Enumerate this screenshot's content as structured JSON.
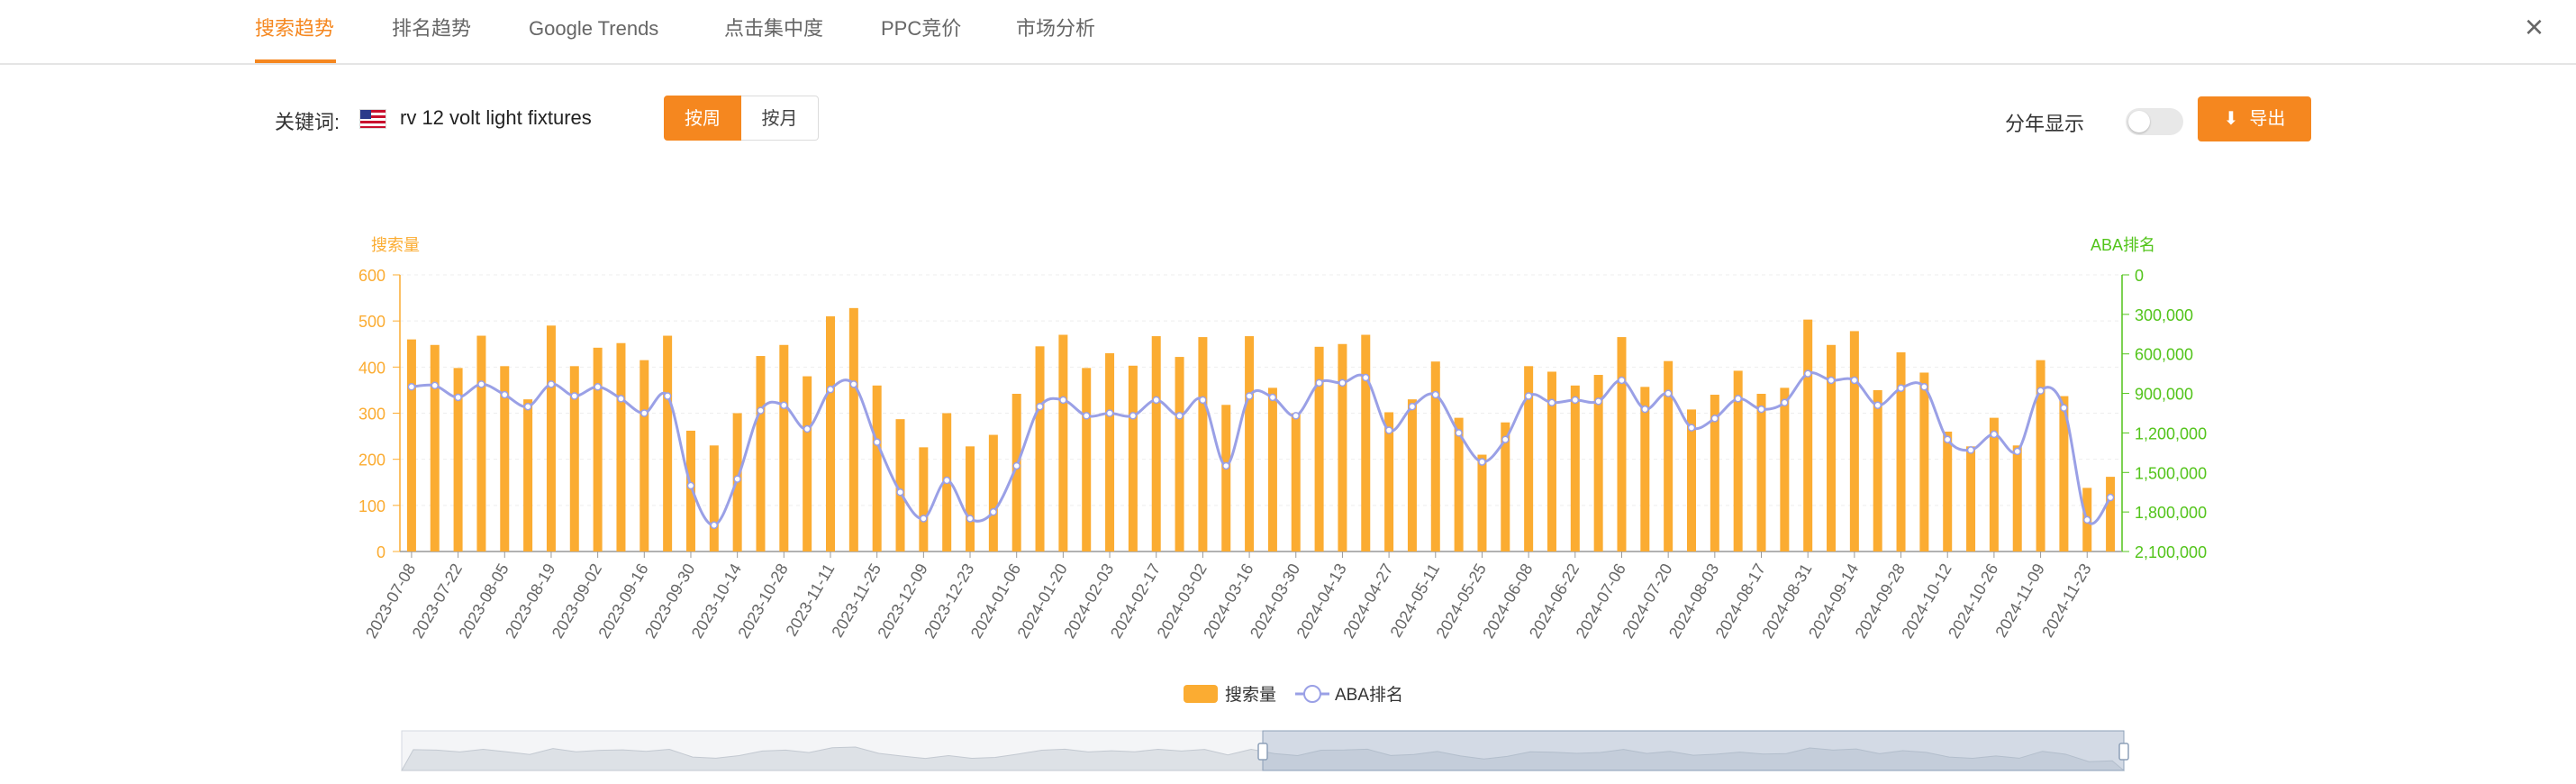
{
  "tabs": [
    {
      "label": "搜索趋势",
      "active": true
    },
    {
      "label": "排名趋势",
      "active": false
    },
    {
      "label": "Google Trends",
      "active": false
    },
    {
      "label": "点击集中度",
      "active": false
    },
    {
      "label": "PPC竞价",
      "active": false
    },
    {
      "label": "市场分析",
      "active": false
    }
  ],
  "close_icon": "×",
  "keyword": {
    "label": "关键词:",
    "flag_icon": "us-flag-icon",
    "value": "rv 12 volt light fixtures"
  },
  "period_toggle": {
    "weekly": "按周",
    "monthly": "按月",
    "selected": "按周"
  },
  "year_split": {
    "label": "分年显示",
    "on": false
  },
  "export_button": {
    "label": "导出",
    "icon": "download-icon"
  },
  "colors": {
    "accent": "#f5871f",
    "bar": "#fbac32",
    "line": "#9aa0e6",
    "right_axis": "#52c41a"
  },
  "chart_data": {
    "type": "bar",
    "y_left_label": "搜索量",
    "y_right_label": "ABA排名",
    "ylim_left": [
      0,
      600
    ],
    "yticks_left": [
      "0",
      "100",
      "200",
      "300",
      "400",
      "500",
      "600"
    ],
    "ylim_right": [
      0,
      2100000
    ],
    "yticks_right": [
      "0",
      "300,000",
      "600,000",
      "900,000",
      "1,200,000",
      "1,500,000",
      "1,800,000",
      "2,100,000"
    ],
    "right_axis_inverted": true,
    "grid": true,
    "legend_position": "bottom",
    "series": [
      {
        "name": "搜索量",
        "type": "bar",
        "values": [
          460,
          448,
          398,
          468,
          402,
          330,
          490,
          402,
          442,
          452,
          415,
          468,
          262,
          230,
          300,
          424,
          448,
          380,
          510,
          528,
          360,
          287,
          226,
          300,
          228,
          253,
          342,
          445,
          470,
          398,
          430,
          403,
          467,
          422,
          465,
          318,
          467,
          355,
          300,
          444,
          450,
          470,
          302,
          330,
          412,
          290,
          210,
          280,
          402,
          390,
          360,
          383,
          465,
          357,
          413,
          308,
          340,
          392,
          342,
          355,
          503,
          448,
          478,
          350,
          432,
          388,
          260,
          228,
          290,
          230,
          415,
          337,
          138,
          162
        ]
      },
      {
        "name": "ABA排名",
        "type": "line",
        "values": [
          850000,
          840000,
          930000,
          830000,
          910000,
          1000000,
          830000,
          920000,
          850000,
          940000,
          1050000,
          920000,
          1600000,
          1900000,
          1550000,
          1030000,
          990000,
          1170000,
          870000,
          830000,
          1270000,
          1650000,
          1850000,
          1560000,
          1850000,
          1800000,
          1450000,
          1000000,
          950000,
          1070000,
          1050000,
          1070000,
          950000,
          1070000,
          950000,
          1450000,
          920000,
          930000,
          1070000,
          820000,
          820000,
          780000,
          1180000,
          1000000,
          910000,
          1200000,
          1420000,
          1250000,
          920000,
          970000,
          950000,
          960000,
          800000,
          1020000,
          900000,
          1160000,
          1090000,
          940000,
          1020000,
          970000,
          750000,
          800000,
          800000,
          990000,
          860000,
          850000,
          1250000,
          1330000,
          1210000,
          1340000,
          880000,
          1010000,
          1860000,
          1690000
        ]
      }
    ],
    "tick_labels": [
      "2023-07-08",
      "2023-07-22",
      "2023-08-05",
      "2023-08-19",
      "2023-09-02",
      "2023-09-16",
      "2023-09-30",
      "2023-10-14",
      "2023-10-28",
      "2023-11-11",
      "2023-11-25",
      "2023-12-09",
      "2023-12-23",
      "2024-01-06",
      "2024-01-20",
      "2024-02-03",
      "2024-02-17",
      "2024-03-02",
      "2024-03-16",
      "2024-03-30",
      "2024-04-13",
      "2024-04-27",
      "2024-05-11",
      "2024-05-25",
      "2024-06-08",
      "2024-06-22",
      "2024-07-06",
      "2024-07-20",
      "2024-08-03",
      "2024-08-17",
      "2024-08-31",
      "2024-09-14",
      "2024-09-28",
      "2024-10-12",
      "2024-10-26",
      "2024-11-09",
      "2024-11-23"
    ],
    "tick_every": 2,
    "data_zoom": {
      "start_fraction": 0.5,
      "end_fraction": 1.0
    }
  }
}
